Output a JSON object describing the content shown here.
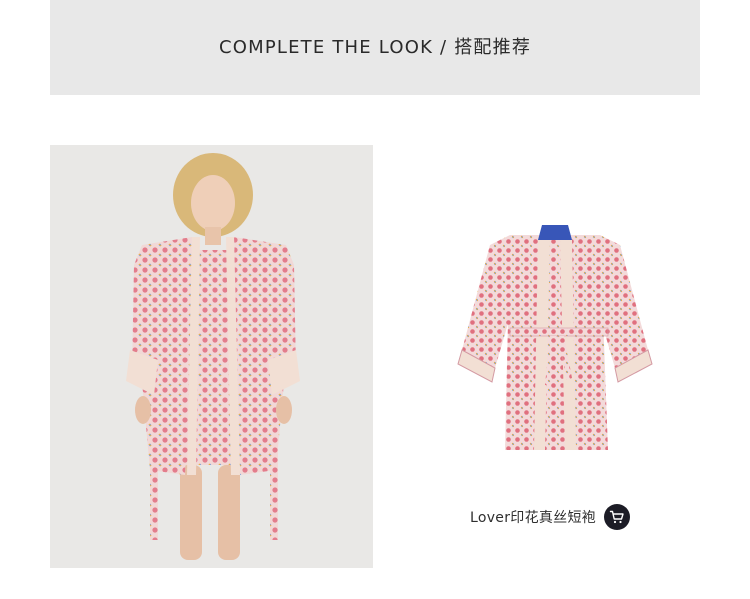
{
  "header": {
    "title": "COMPLETE THE LOOK / 搭配推荐"
  },
  "product": {
    "name": "Lover印花真丝短袍",
    "cart_icon": "cart-icon"
  },
  "colors": {
    "header_bg": "#e8e8e8",
    "photo_bg": "#e9e8e6",
    "robe_pink": "#e6a9b3",
    "trim_blush": "#f2dfd4",
    "cart_bg": "#1c1c26"
  }
}
